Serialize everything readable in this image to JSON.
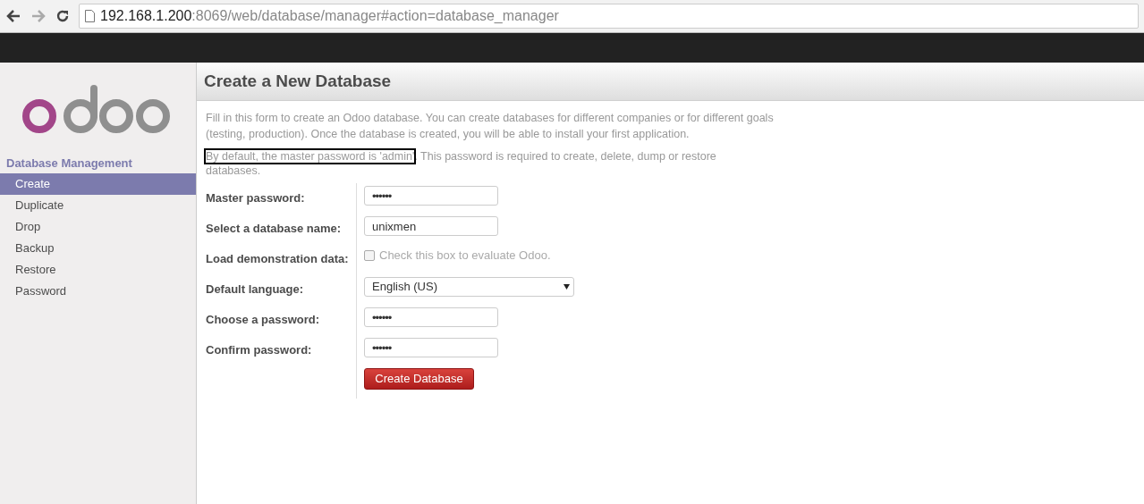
{
  "browser": {
    "url_host": "192.168.1.200",
    "url_rest": ":8069/web/database/manager#action=database_manager"
  },
  "sidebar": {
    "section": "Database Management",
    "items": [
      {
        "label": "Create",
        "selected": true
      },
      {
        "label": "Duplicate",
        "selected": false
      },
      {
        "label": "Drop",
        "selected": false
      },
      {
        "label": "Backup",
        "selected": false
      },
      {
        "label": "Restore",
        "selected": false
      },
      {
        "label": "Password",
        "selected": false
      }
    ]
  },
  "main": {
    "title": "Create a New Database",
    "intro": "Fill in this form to create an Odoo database. You can create databases for different companies or for different goals (testing, production). Once the database is created, you will be able to install your first application.",
    "note_highlighted": "By default, the master password is 'admin'",
    "note_rest": ". This password is required to create, delete, dump or restore databases.",
    "fields": [
      {
        "kind": "password",
        "label": "Master password:",
        "value": "••••••"
      },
      {
        "kind": "text",
        "label": "Select a database name:",
        "value": "unixmen"
      },
      {
        "kind": "checkbox",
        "label": "Load demonstration data:",
        "checked": false,
        "hint": "Check this box to evaluate Odoo."
      },
      {
        "kind": "select",
        "label": "Default language:",
        "value": "English (US)"
      },
      {
        "kind": "password",
        "label": "Choose a password:",
        "value": "••••••"
      },
      {
        "kind": "password",
        "label": "Confirm password:",
        "value": "••••••"
      }
    ],
    "submit": "Create Database"
  }
}
